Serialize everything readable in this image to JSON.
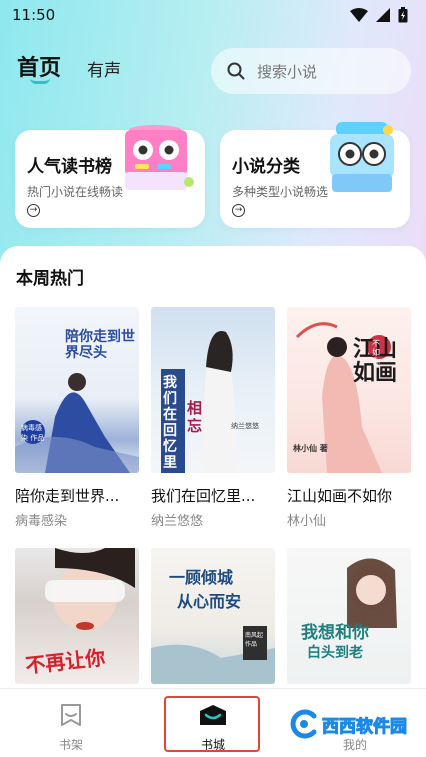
{
  "status_bar": {
    "time": "11:50"
  },
  "header": {
    "tab_home": "首页",
    "tab_audio": "有声",
    "search_placeholder": "搜索小说"
  },
  "cards": [
    {
      "title": "人气读书榜",
      "subtitle": "热门小说在线畅读"
    },
    {
      "title": "小说分类",
      "subtitle": "多种类型小说畅选"
    }
  ],
  "section": {
    "title": "本周热门",
    "books": [
      {
        "title": "陪你走到世界...",
        "author": "病毒感染",
        "cover_text": "陪你走到世界尽头",
        "cover_badge": "病毒感染 作品"
      },
      {
        "title": "我们在回忆里...",
        "author": "纳兰悠悠",
        "cover_text_a": "我们在回忆里",
        "cover_text_b": "相忘",
        "cover_small": "纳兰悠悠"
      },
      {
        "title": "江山如画不如你",
        "author": "林小仙",
        "cover_text": "江山如画",
        "cover_badge": "不如你",
        "cover_small": "林小仙 著"
      },
      {
        "cover_text": "不再让你"
      },
      {
        "cover_text_a": "一顾倾城",
        "cover_text_b": "从心而安",
        "cover_small": "南风起 作品"
      },
      {
        "cover_text_a": "我想和你",
        "cover_text_b": "白头到老"
      }
    ]
  },
  "bottom_nav": {
    "items": [
      {
        "label": "书架"
      },
      {
        "label": "书城"
      },
      {
        "label": "我的"
      }
    ]
  },
  "watermark": {
    "text": "西西软件园"
  },
  "colors": {
    "accent": "#2cc3c8",
    "highlight_box": "#e24535"
  }
}
